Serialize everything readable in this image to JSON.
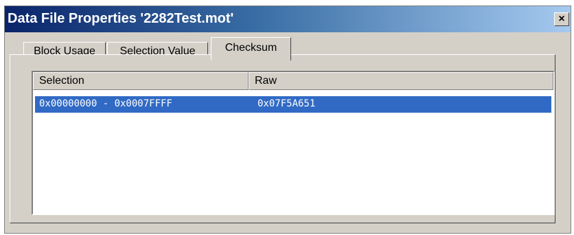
{
  "window": {
    "title": "Data File Properties '2282Test.mot'",
    "close_label": "×"
  },
  "tabs": [
    {
      "label": "Block Usage",
      "active": false
    },
    {
      "label": "Selection Value",
      "active": false
    },
    {
      "label": "Checksum",
      "active": true
    }
  ],
  "listview": {
    "columns": [
      "Selection",
      "Raw"
    ],
    "rows": [
      {
        "selection": "0x00000000 - 0x0007FFFF",
        "raw": "0x07F5A651",
        "selected": true
      }
    ]
  },
  "colors": {
    "selection_highlight": "#316ac5",
    "titlebar_start": "#0a246a",
    "titlebar_end": "#a6caf0"
  }
}
